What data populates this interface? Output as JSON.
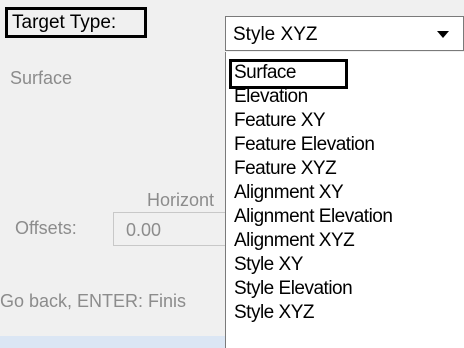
{
  "target_type": {
    "label": "Target Type:",
    "selected": "Style XYZ"
  },
  "background": {
    "surface_label": "Surface",
    "horizontal_label": "Horizont",
    "offsets_label": "Offsets:",
    "offsets_value": "0.00",
    "status_text": "Go back, ENTER: Finis"
  },
  "dropdown": {
    "options": [
      "Surface",
      "Elevation",
      "Feature XY",
      "Feature Elevation",
      "Feature XYZ",
      "Alignment XY",
      "Alignment Elevation",
      "Alignment XYZ",
      "Style XY",
      "Style Elevation",
      "Style XYZ"
    ],
    "highlighted": "Surface"
  }
}
